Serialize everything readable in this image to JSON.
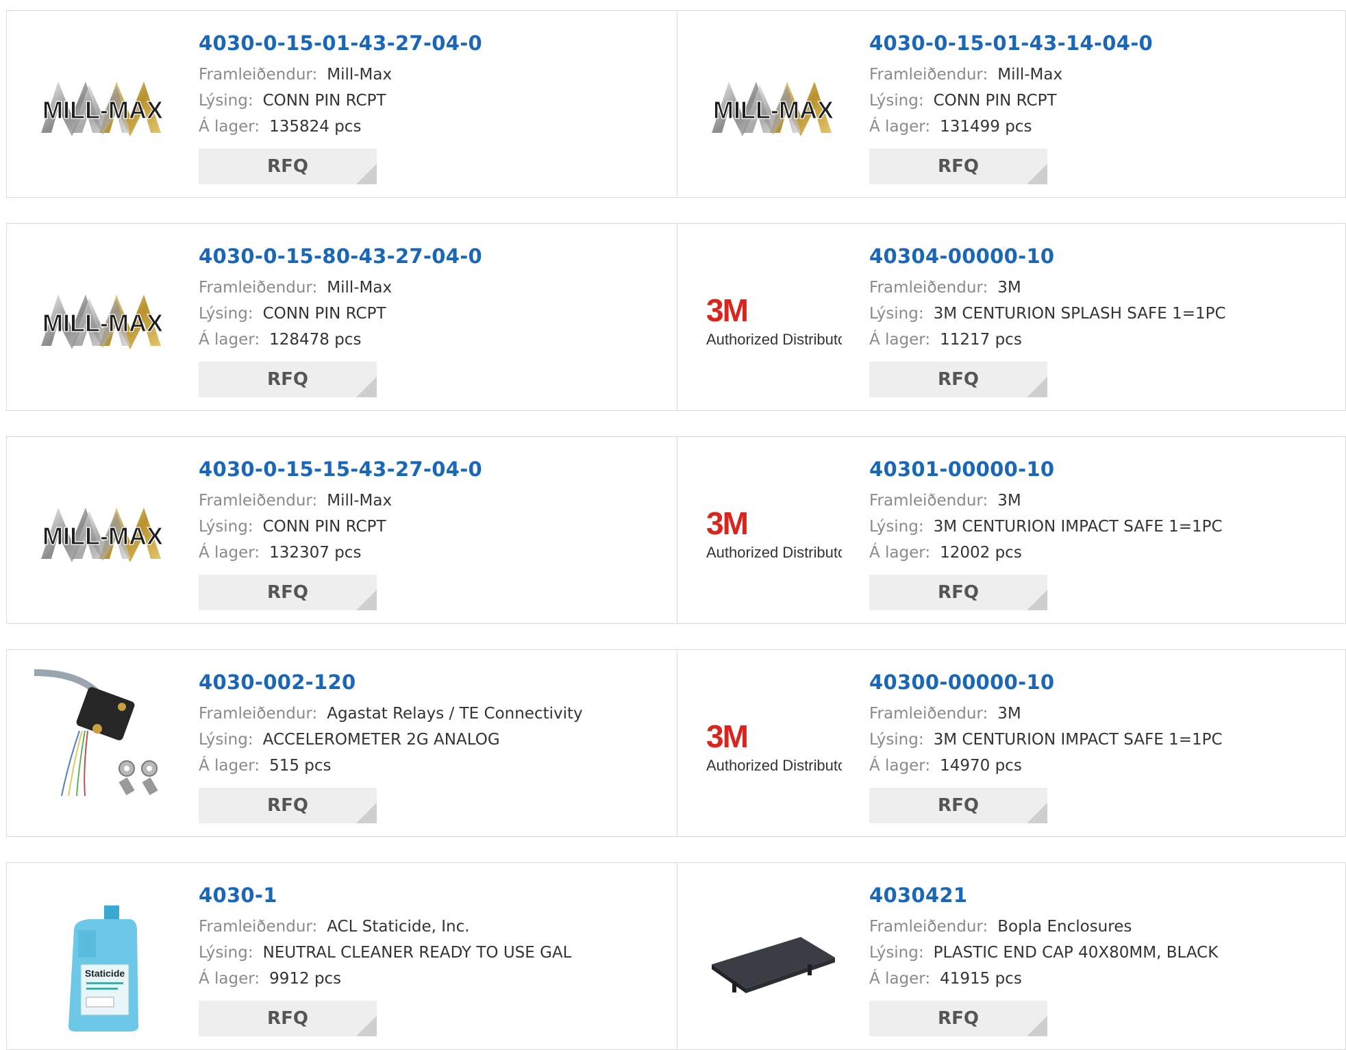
{
  "labels": {
    "manufacturer": "Framleiðendur:",
    "description": "Lýsing:",
    "stock": "Á lager:",
    "rfq": "RFQ"
  },
  "logos": {
    "millmax": "MILL-MAX",
    "threem": "3M",
    "threem_sub": "Authorized Distributor",
    "bottle": "Staticide"
  },
  "products": [
    {
      "part": "4030-0-15-01-43-27-04-0",
      "manufacturer": "Mill-Max",
      "description": "CONN PIN RCPT",
      "stock": "135824 pcs",
      "logo": "millmax"
    },
    {
      "part": "4030-0-15-01-43-14-04-0",
      "manufacturer": "Mill-Max",
      "description": "CONN PIN RCPT",
      "stock": "131499 pcs",
      "logo": "millmax"
    },
    {
      "part": "4030-0-15-80-43-27-04-0",
      "manufacturer": "Mill-Max",
      "description": "CONN PIN RCPT",
      "stock": "128478 pcs",
      "logo": "millmax"
    },
    {
      "part": "40304-00000-10",
      "manufacturer": "3M",
      "description": "3M CENTURION SPLASH SAFE 1=1PC",
      "stock": "11217 pcs",
      "logo": "threem"
    },
    {
      "part": "4030-0-15-15-43-27-04-0",
      "manufacturer": "Mill-Max",
      "description": "CONN PIN RCPT",
      "stock": "132307 pcs",
      "logo": "millmax"
    },
    {
      "part": "40301-00000-10",
      "manufacturer": "3M",
      "description": "3M CENTURION IMPACT SAFE 1=1PC",
      "stock": "12002 pcs",
      "logo": "threem"
    },
    {
      "part": "4030-002-120",
      "manufacturer": "Agastat Relays / TE Connectivity",
      "description": "ACCELEROMETER 2G ANALOG",
      "stock": "515 pcs",
      "logo": "accelerometer"
    },
    {
      "part": "40300-00000-10",
      "manufacturer": "3M",
      "description": "3M CENTURION IMPACT SAFE 1=1PC",
      "stock": "14970 pcs",
      "logo": "threem"
    },
    {
      "part": "4030-1",
      "manufacturer": "ACL Staticide, Inc.",
      "description": "NEUTRAL CLEANER READY TO USE GAL",
      "stock": "9912 pcs",
      "logo": "bottle"
    },
    {
      "part": "4030421",
      "manufacturer": "Bopla Enclosures",
      "description": "PLASTIC END CAP 40X80MM, BLACK",
      "stock": "41915 pcs",
      "logo": "endcap"
    }
  ],
  "colors": {
    "link": "#1a67b8",
    "label": "#8a8a8a",
    "border": "#d9d9d9",
    "rfq_bg": "#eeeeee",
    "brand_3m": "#d9251d"
  }
}
